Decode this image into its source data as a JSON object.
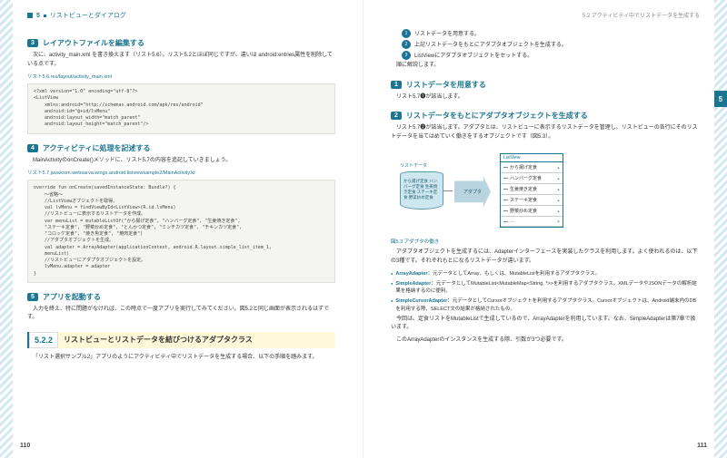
{
  "left": {
    "runhead": {
      "chap": "5",
      "title": "リストビューとダイアログ"
    },
    "step3": {
      "num": "3",
      "title": "レイアウトファイルを編集する"
    },
    "p3": "次に、activity_main.xml を書き換えます（リスト5.6）。リスト5.2とほぼ同じですが、違いは android:entries属性を削除している点です。",
    "cap56": "リスト5.6  res/layout/activity_main.xml",
    "code56": "<?xml version=\"1.0\" encoding=\"utf-8\"?>\n<ListView\n    xmlns:android=\"http://schemas.android.com/apk/res/android\"\n    android:id=\"@+id/lvMenu\"\n    android:layout_width=\"match_parent\"\n    android:layout_height=\"match_parent\"/>",
    "step4": {
      "num": "4",
      "title": "アクティビティに処理を記述する"
    },
    "p4": "MainActivityのonCreate()メソッドに、リスト5.7の内容を追記していきましょう。",
    "cap57": "リスト5.7  java/com.websarva.wings.android.listviewsample2/MainActivity.kt",
    "code57": "override fun onCreate(savedInstanceState: Bundle?) {\n    ～省略～\n    //ListViewオブジェクトを取得。\n    val lvMenu = findViewById<ListView>(R.id.lvMenu)\n    //リストビューに表示するリストデータを作成。\n    var menuList = mutableListOf(\"から揚げ定食\", \"ハンバーグ定食\", \"生姜焼き定食\",\n    \"ステーキ定食\", \"野菜炒め定食\", \"とんかつ定食\", \"ミンチカツ定食\", \"チキンカツ定食\",\n    \"コロッケ定食\", \"焼き魚定食\", \"焼肉定食\")\n    //アダプタオブジェクトを生成。\n    val adapter = ArrayAdapter(applicationContext, android.R.layout.simple_list_item_1,\n    menuList)\n    //リストビューにアダプタオブジェクトを設定。\n    lvMenu.adapter = adapter\n}",
    "step5": {
      "num": "5",
      "title": "アプリを起動する"
    },
    "p5": "入力を終え、特に問題がなければ、この時点で一度アプリを実行してみてください。図5.2と同じ画面が表示されるはずです。",
    "sec": {
      "num": "5.2.2",
      "title": "リストビューとリストデータを結びつけるアダプタクラス"
    },
    "psec": "「リスト選択サンプル2」アプリのようにアクティビティ中でリストデータを生成する場合、以下の手順を踏みます。",
    "pn": "110"
  },
  "right": {
    "runhead": "5.2  アクティビティ中でリストデータを生成する",
    "ol": [
      "リストデータを用意する。",
      "上記リストデータをもとにアダプタオブジェクトを生成する。",
      "ListViewにアダプタオブジェクトをセットする。"
    ],
    "p0": "順に解説します。",
    "step1": {
      "num": "1",
      "title": "リストデータを用意する"
    },
    "p1": "リスト5.7❶が該当します。",
    "step2": {
      "num": "2",
      "title": "リストデータをもとにアダプタオブジェクトを生成する"
    },
    "p2": "リスト5.7❷が該当します。アダプタとは、リストビューに表示するリストデータを管理し、リストビューの各行にそのリストデータを当てはめていく働きをするオブジェクトです（図5.3）。",
    "cylLabel": "リストデータ",
    "cylItems": "から揚げ定食\nハンバーグ定食\n生姜焼き定食\nステーキ定食\n野菜炒め定食",
    "adapter": "アダプタ",
    "lvHead": "ListView",
    "lvRows": [
      "から揚げ定食",
      "ハンバーグ定食",
      "生姜焼き定食",
      "ステーキ定食",
      "野菜炒め定食",
      "…"
    ],
    "figcap": "図5.3  アダプタの働き",
    "p3": "アダプタオブジェクトを生成するには、Adapterインターフェースを実装したクラスを利用します。よく使われるのは、以下の3種です。それぞれもとになるリストデータが違います。",
    "b1t": "ArrayAdapter：",
    "b1": "元データとしてArray、もしくは、MutableListを利用するアダプタクラス。",
    "b2t": "SimpleAdapter：",
    "b2": "元データとしてMutableList<MutableMap<String, *>>を利用するアダプタクラス。XMLデータやJSONデータの解析結果を格納するのに便利。",
    "b3t": "SimpleCursorAdapter：",
    "b3": "元データとしてCursorオブジェクトを利用するアダプタクラス。Cursorオブジェクトは、Android端末内のDBを利用する際、SELECT文の結果が格納されたもの。",
    "p4": "今回は、定食リストをMutableListで生成しているので、ArrayAdapterを利用しています。なお、SimpleAdapterは第7章で扱います。",
    "p5": "このArrayAdapterのインスタンスを生成する際、引数が3つ必要です。",
    "pn": "111",
    "chap": "5"
  }
}
